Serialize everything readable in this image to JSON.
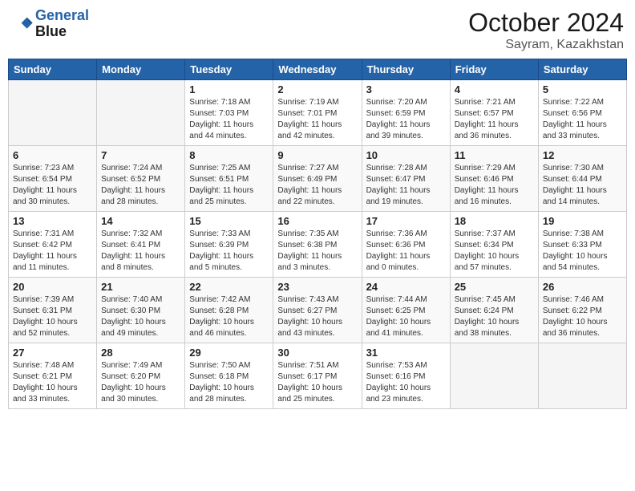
{
  "header": {
    "logo_line1": "General",
    "logo_line2": "Blue",
    "month": "October 2024",
    "location": "Sayram, Kazakhstan"
  },
  "weekdays": [
    "Sunday",
    "Monday",
    "Tuesday",
    "Wednesday",
    "Thursday",
    "Friday",
    "Saturday"
  ],
  "weeks": [
    [
      {
        "day": "",
        "empty": true
      },
      {
        "day": "",
        "empty": true
      },
      {
        "day": "1",
        "sunrise": "Sunrise: 7:18 AM",
        "sunset": "Sunset: 7:03 PM",
        "daylight": "Daylight: 11 hours and 44 minutes."
      },
      {
        "day": "2",
        "sunrise": "Sunrise: 7:19 AM",
        "sunset": "Sunset: 7:01 PM",
        "daylight": "Daylight: 11 hours and 42 minutes."
      },
      {
        "day": "3",
        "sunrise": "Sunrise: 7:20 AM",
        "sunset": "Sunset: 6:59 PM",
        "daylight": "Daylight: 11 hours and 39 minutes."
      },
      {
        "day": "4",
        "sunrise": "Sunrise: 7:21 AM",
        "sunset": "Sunset: 6:57 PM",
        "daylight": "Daylight: 11 hours and 36 minutes."
      },
      {
        "day": "5",
        "sunrise": "Sunrise: 7:22 AM",
        "sunset": "Sunset: 6:56 PM",
        "daylight": "Daylight: 11 hours and 33 minutes."
      }
    ],
    [
      {
        "day": "6",
        "sunrise": "Sunrise: 7:23 AM",
        "sunset": "Sunset: 6:54 PM",
        "daylight": "Daylight: 11 hours and 30 minutes."
      },
      {
        "day": "7",
        "sunrise": "Sunrise: 7:24 AM",
        "sunset": "Sunset: 6:52 PM",
        "daylight": "Daylight: 11 hours and 28 minutes."
      },
      {
        "day": "8",
        "sunrise": "Sunrise: 7:25 AM",
        "sunset": "Sunset: 6:51 PM",
        "daylight": "Daylight: 11 hours and 25 minutes."
      },
      {
        "day": "9",
        "sunrise": "Sunrise: 7:27 AM",
        "sunset": "Sunset: 6:49 PM",
        "daylight": "Daylight: 11 hours and 22 minutes."
      },
      {
        "day": "10",
        "sunrise": "Sunrise: 7:28 AM",
        "sunset": "Sunset: 6:47 PM",
        "daylight": "Daylight: 11 hours and 19 minutes."
      },
      {
        "day": "11",
        "sunrise": "Sunrise: 7:29 AM",
        "sunset": "Sunset: 6:46 PM",
        "daylight": "Daylight: 11 hours and 16 minutes."
      },
      {
        "day": "12",
        "sunrise": "Sunrise: 7:30 AM",
        "sunset": "Sunset: 6:44 PM",
        "daylight": "Daylight: 11 hours and 14 minutes."
      }
    ],
    [
      {
        "day": "13",
        "sunrise": "Sunrise: 7:31 AM",
        "sunset": "Sunset: 6:42 PM",
        "daylight": "Daylight: 11 hours and 11 minutes."
      },
      {
        "day": "14",
        "sunrise": "Sunrise: 7:32 AM",
        "sunset": "Sunset: 6:41 PM",
        "daylight": "Daylight: 11 hours and 8 minutes."
      },
      {
        "day": "15",
        "sunrise": "Sunrise: 7:33 AM",
        "sunset": "Sunset: 6:39 PM",
        "daylight": "Daylight: 11 hours and 5 minutes."
      },
      {
        "day": "16",
        "sunrise": "Sunrise: 7:35 AM",
        "sunset": "Sunset: 6:38 PM",
        "daylight": "Daylight: 11 hours and 3 minutes."
      },
      {
        "day": "17",
        "sunrise": "Sunrise: 7:36 AM",
        "sunset": "Sunset: 6:36 PM",
        "daylight": "Daylight: 11 hours and 0 minutes."
      },
      {
        "day": "18",
        "sunrise": "Sunrise: 7:37 AM",
        "sunset": "Sunset: 6:34 PM",
        "daylight": "Daylight: 10 hours and 57 minutes."
      },
      {
        "day": "19",
        "sunrise": "Sunrise: 7:38 AM",
        "sunset": "Sunset: 6:33 PM",
        "daylight": "Daylight: 10 hours and 54 minutes."
      }
    ],
    [
      {
        "day": "20",
        "sunrise": "Sunrise: 7:39 AM",
        "sunset": "Sunset: 6:31 PM",
        "daylight": "Daylight: 10 hours and 52 minutes."
      },
      {
        "day": "21",
        "sunrise": "Sunrise: 7:40 AM",
        "sunset": "Sunset: 6:30 PM",
        "daylight": "Daylight: 10 hours and 49 minutes."
      },
      {
        "day": "22",
        "sunrise": "Sunrise: 7:42 AM",
        "sunset": "Sunset: 6:28 PM",
        "daylight": "Daylight: 10 hours and 46 minutes."
      },
      {
        "day": "23",
        "sunrise": "Sunrise: 7:43 AM",
        "sunset": "Sunset: 6:27 PM",
        "daylight": "Daylight: 10 hours and 43 minutes."
      },
      {
        "day": "24",
        "sunrise": "Sunrise: 7:44 AM",
        "sunset": "Sunset: 6:25 PM",
        "daylight": "Daylight: 10 hours and 41 minutes."
      },
      {
        "day": "25",
        "sunrise": "Sunrise: 7:45 AM",
        "sunset": "Sunset: 6:24 PM",
        "daylight": "Daylight: 10 hours and 38 minutes."
      },
      {
        "day": "26",
        "sunrise": "Sunrise: 7:46 AM",
        "sunset": "Sunset: 6:22 PM",
        "daylight": "Daylight: 10 hours and 36 minutes."
      }
    ],
    [
      {
        "day": "27",
        "sunrise": "Sunrise: 7:48 AM",
        "sunset": "Sunset: 6:21 PM",
        "daylight": "Daylight: 10 hours and 33 minutes."
      },
      {
        "day": "28",
        "sunrise": "Sunrise: 7:49 AM",
        "sunset": "Sunset: 6:20 PM",
        "daylight": "Daylight: 10 hours and 30 minutes."
      },
      {
        "day": "29",
        "sunrise": "Sunrise: 7:50 AM",
        "sunset": "Sunset: 6:18 PM",
        "daylight": "Daylight: 10 hours and 28 minutes."
      },
      {
        "day": "30",
        "sunrise": "Sunrise: 7:51 AM",
        "sunset": "Sunset: 6:17 PM",
        "daylight": "Daylight: 10 hours and 25 minutes."
      },
      {
        "day": "31",
        "sunrise": "Sunrise: 7:53 AM",
        "sunset": "Sunset: 6:16 PM",
        "daylight": "Daylight: 10 hours and 23 minutes."
      },
      {
        "day": "",
        "empty": true
      },
      {
        "day": "",
        "empty": true
      }
    ]
  ]
}
